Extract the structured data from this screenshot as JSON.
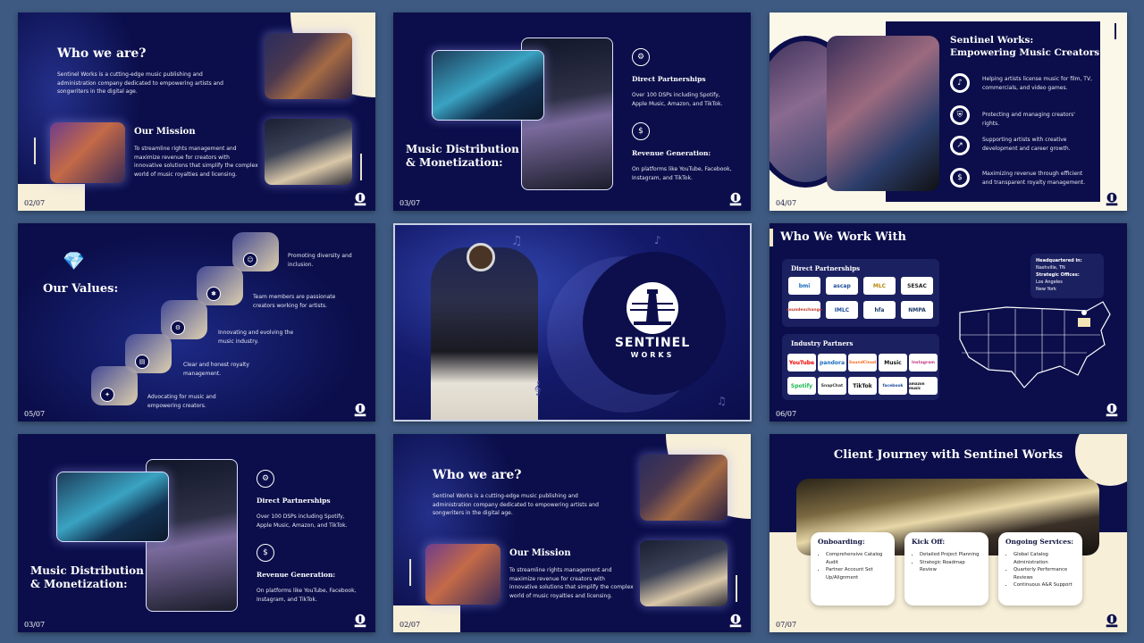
{
  "slide1": {
    "title": "Who we are?",
    "intro": "Sentinel Works is a cutting-edge music publishing and administration company dedicated to empowering artists and songwriters in the digital age.",
    "mission_title": "Our Mission",
    "mission_text": "To streamline rights management and maximize revenue for creators with innovative solutions that simplify the complex world of music royalties and licensing.",
    "page": "02/07"
  },
  "slide2": {
    "title_line1": "Music Distribution",
    "title_line2": "& Monetization:",
    "item1_title": "Direct Partnerships",
    "item1_text": "Over 100 DSPs including Spotify, Apple Music, Amazon, and TikTok.",
    "item2_title": "Revenue Generation:",
    "item2_text": "On platforms like YouTube, Facebook, Instagram, and TikTok.",
    "page": "03/07"
  },
  "slide3": {
    "title_line1": "Sentinel Works:",
    "title_line2": "Empowering Music Creators",
    "items": [
      "Helping artists license music for film, TV, commercials, and video games.",
      "Protecting and managing creators' rights.",
      "Supporting artists with creative development and career growth.",
      "Maximizing revenue through efficient and transparent royalty management."
    ],
    "page": "04/07"
  },
  "slide4": {
    "title": "Our Values:",
    "values": [
      "Promoting diversity and inclusion.",
      "Team members are passionate creators working for artists.",
      "Innovating and evolving the music industry.",
      "Clear and honest royalty management.",
      "Advocating for music and empowering creators."
    ],
    "page": "05/07"
  },
  "slide5": {
    "brand_line1": "SENTINEL",
    "brand_line2": "WORKS"
  },
  "slide6": {
    "title": "Who We Work With",
    "direct_title": "Direct Partnerships",
    "direct_logos": [
      "bmi",
      "ascap",
      "MLC",
      "SESAC",
      "soundexchange",
      "IMLC",
      "hfa",
      "NMPA"
    ],
    "industry_title": "Industry Partners",
    "industry_logos": [
      "YouTube",
      "pandora",
      "SoundCloud",
      "Music",
      "Instagram",
      "Spotify",
      "SnapChat",
      "TikTok",
      "facebook",
      "amazon music"
    ],
    "hq_label": "Headquartered in:",
    "hq_value": "Nashville, TN",
    "offices_label": "Strategic Offices:",
    "office1": "Los Angeles",
    "office2": "New York",
    "page": "06/07"
  },
  "slide7": {
    "title_line1": "Music Distribution",
    "title_line2": "& Monetization:",
    "item1_title": "Direct Partnerships",
    "item1_text": "Over 100 DSPs including Spotify, Apple Music, Amazon, and TikTok.",
    "item2_title": "Revenue Generation:",
    "item2_text": "On platforms like YouTube, Facebook, Instagram, and TikTok.",
    "page": "03/07"
  },
  "slide8": {
    "title": "Who we are?",
    "intro": "Sentinel Works is a cutting-edge music publishing and administration company dedicated to empowering artists and songwriters in the digital age.",
    "mission_title": "Our Mission",
    "mission_text": "To streamline rights management and maximize revenue for creators with innovative solutions that simplify the complex world of music royalties and licensing.",
    "page": "02/07"
  },
  "slide9": {
    "title": "Client Journey with Sentinel Works",
    "cards": [
      {
        "title": "Onboarding:",
        "items": [
          "Comprehensive Catalog Audit",
          "Partner Account Set Up/Alignment"
        ]
      },
      {
        "title": "Kick Off:",
        "items": [
          "Detailed Project Planning",
          "Strategic Roadmap Review"
        ]
      },
      {
        "title": "Ongoing Services:",
        "items": [
          "Global Catalog Administration",
          "Quarterly Performance Reviews",
          "Continuous A&R Support"
        ]
      }
    ],
    "page": "07/07"
  },
  "colors": {
    "navy": "#0b0e4a",
    "cream": "#f7efd8",
    "background": "#3e5a82"
  },
  "icons": {
    "logo": "sentinel-lighthouse-logo"
  }
}
